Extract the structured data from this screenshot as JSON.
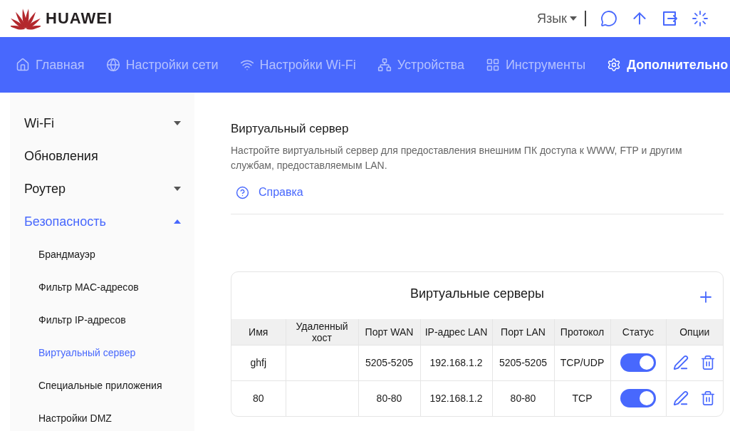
{
  "header": {
    "brand": "HUAWEI",
    "language": "Язык"
  },
  "nav": [
    {
      "label": "Главная",
      "selected": false
    },
    {
      "label": "Настройки сети",
      "selected": false
    },
    {
      "label": "Настройки Wi-Fi",
      "selected": false
    },
    {
      "label": "Устройства",
      "selected": false
    },
    {
      "label": "Инструменты",
      "selected": false
    },
    {
      "label": "Дополнительно",
      "selected": true
    }
  ],
  "sidebar": [
    {
      "label": "Wi-Fi",
      "kind": "group",
      "expanded": false,
      "selected": false
    },
    {
      "label": "Обновления",
      "kind": "link",
      "selected": false
    },
    {
      "label": "Роутер",
      "kind": "group",
      "expanded": false,
      "selected": false
    },
    {
      "label": "Безопасность",
      "kind": "group",
      "expanded": true,
      "selected": true,
      "children": [
        {
          "label": "Брандмауэр",
          "selected": false
        },
        {
          "label": "Фильтр MAC-адресов",
          "selected": false
        },
        {
          "label": "Фильтр IP-адресов",
          "selected": false
        },
        {
          "label": "Виртуальный сервер",
          "selected": true
        },
        {
          "label": "Специальные приложения",
          "selected": false
        },
        {
          "label": "Настройки DMZ",
          "selected": false
        }
      ]
    }
  ],
  "page": {
    "title": "Виртуальный сервер",
    "description": "Настройте виртуальный сервер для предоставления внешним ПК доступа к WWW, FTP и другим службам, предоставляемым LAN.",
    "help": "Справка"
  },
  "table": {
    "title": "Виртуальные серверы",
    "columns": [
      "Имя",
      "Удаленный хост",
      "Порт WAN",
      "IP-адрес LAN",
      "Порт LAN",
      "Протокол",
      "Статус",
      "Опции"
    ],
    "rows": [
      {
        "name": "ghfj",
        "wan_port": "5205-5205",
        "lan_ip": "192.168.1.2",
        "lan_port": "5205-5205",
        "protocol": "TCP/UDP",
        "on": true
      },
      {
        "name": "80",
        "wan_port": "80-80",
        "lan_ip": "192.168.1.2",
        "lan_port": "80-80",
        "protocol": "TCP",
        "on": true
      }
    ]
  }
}
